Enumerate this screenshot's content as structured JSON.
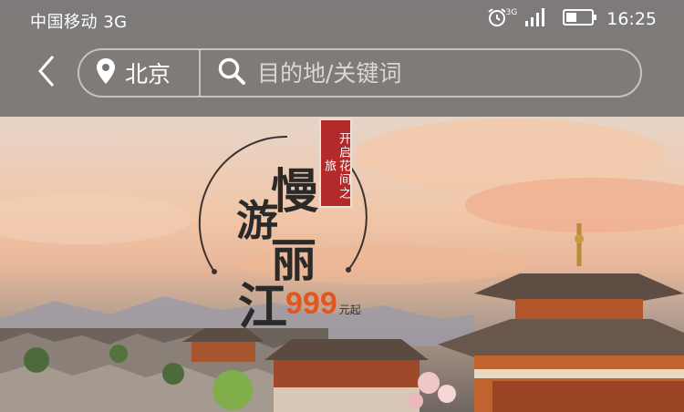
{
  "status_bar": {
    "carrier": "中国移动 3G",
    "network": "3G",
    "time": "16:25"
  },
  "search": {
    "city": "北京",
    "placeholder": "目的地/关键词"
  },
  "banner": {
    "tag": "开启花间之旅",
    "title_chars": [
      "慢",
      "游",
      "丽",
      "江"
    ],
    "price": "999",
    "price_suffix": "元起"
  },
  "colors": {
    "price": "#e2571f",
    "tag_red": "#b22a2a",
    "top_bar": "#767473"
  }
}
